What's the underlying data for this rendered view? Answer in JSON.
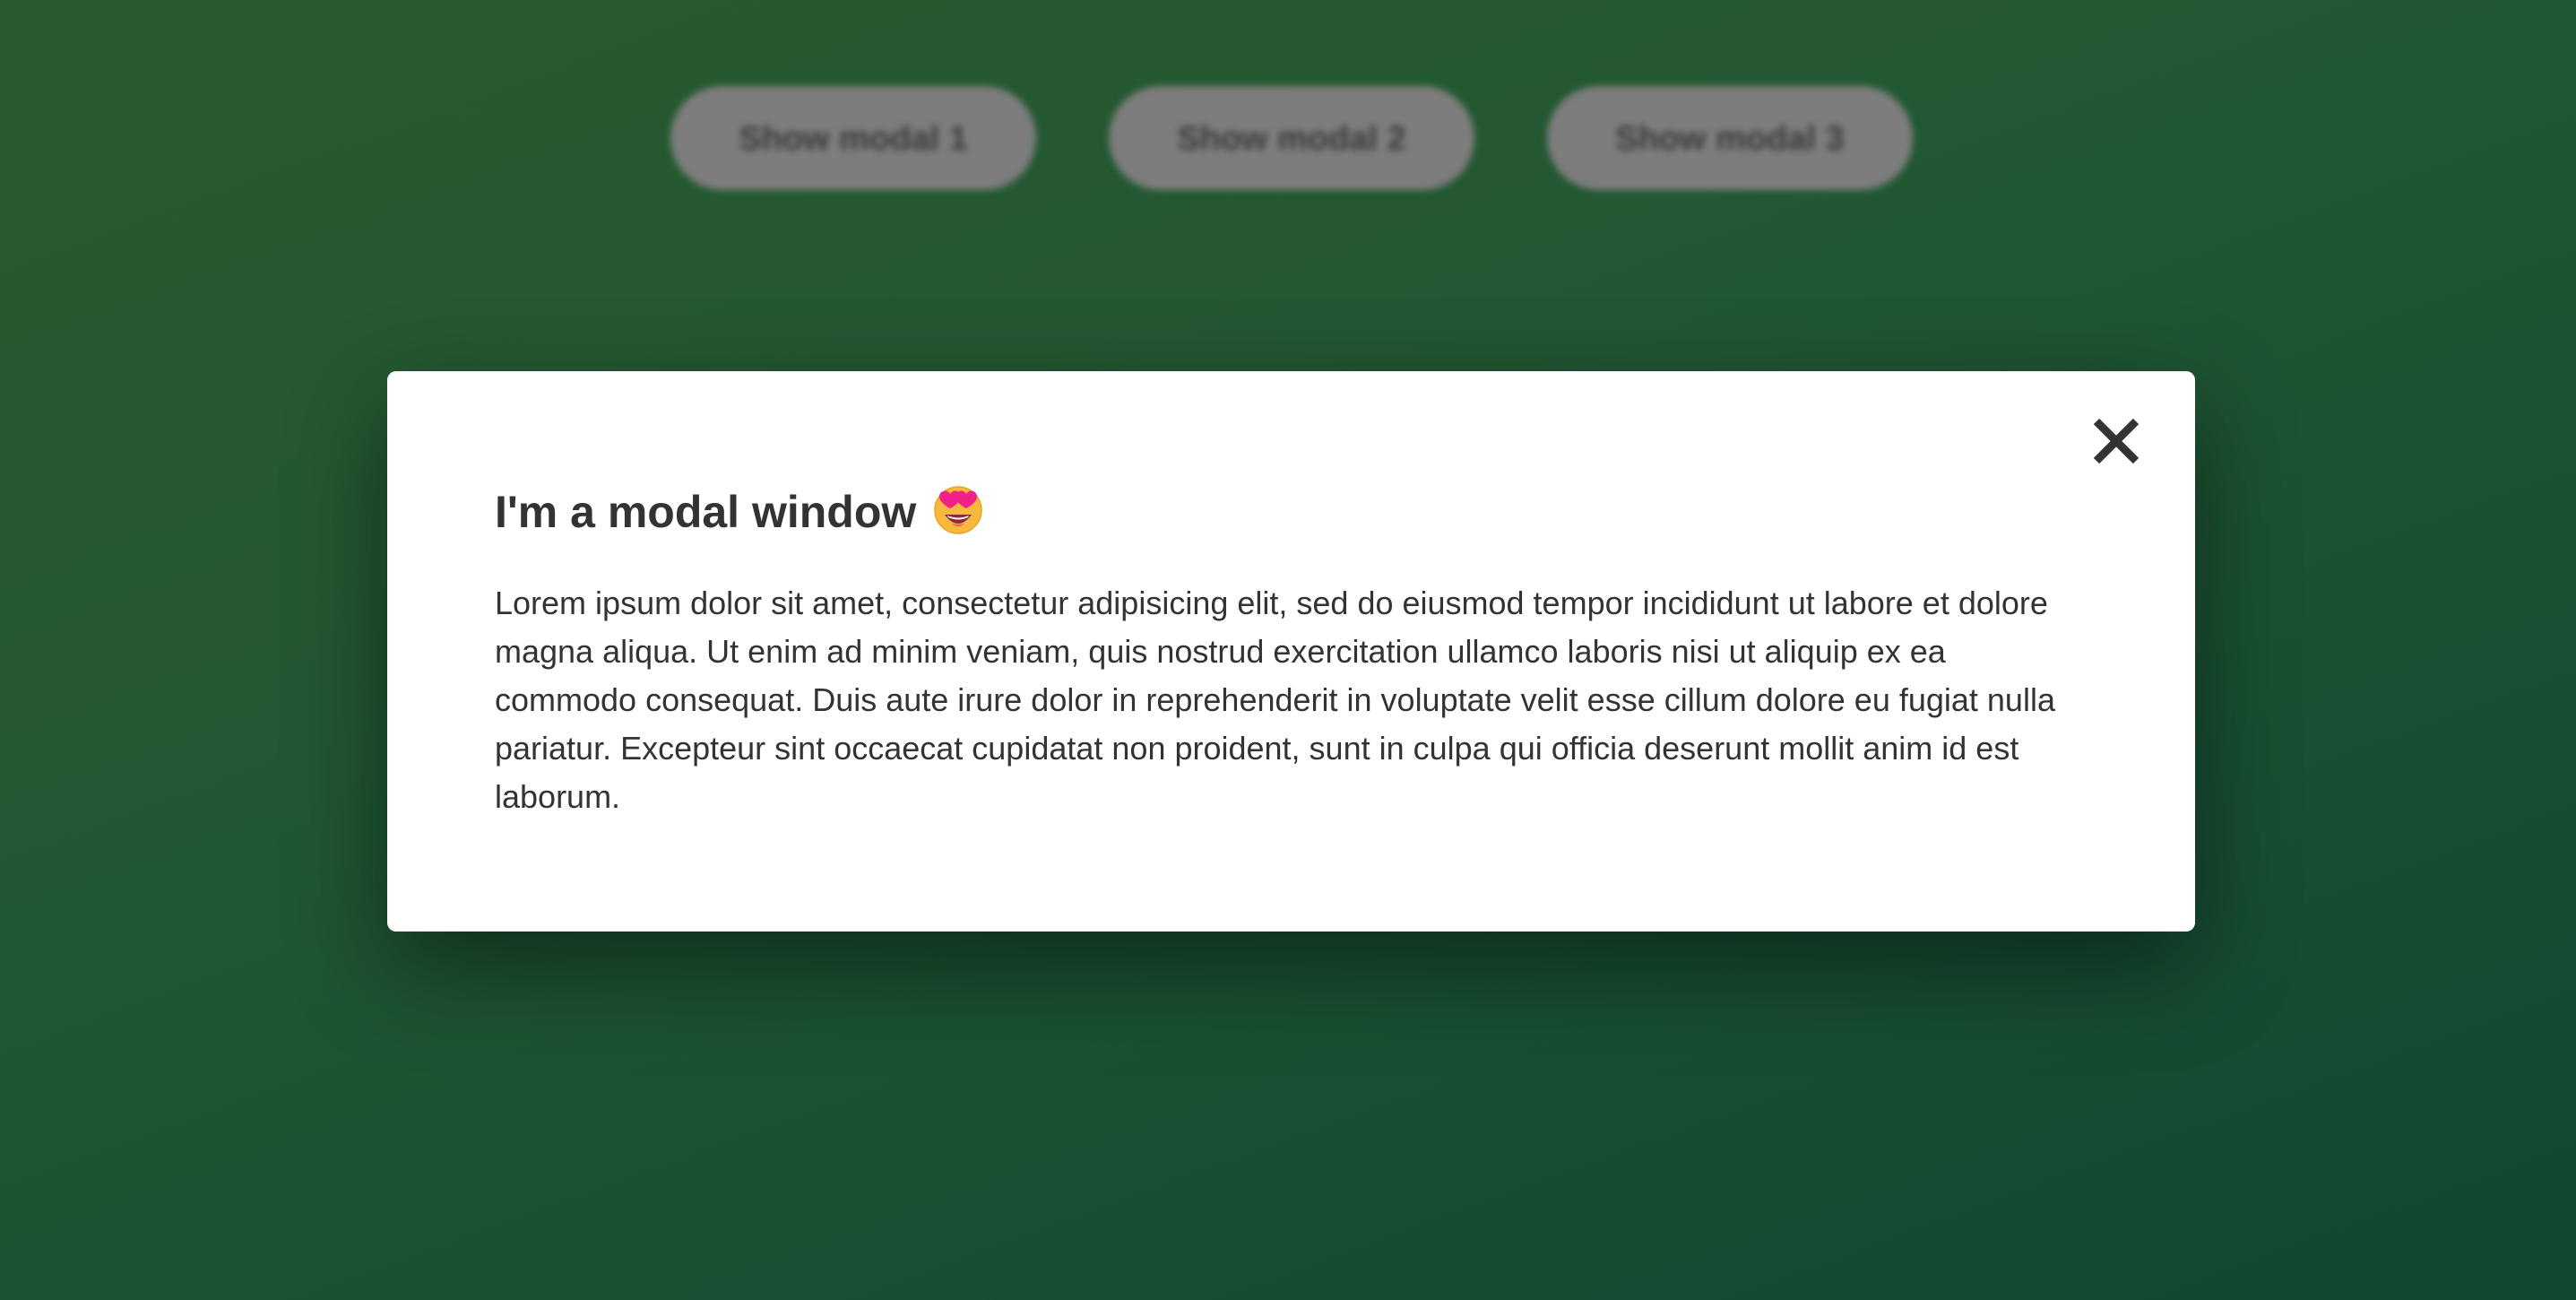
{
  "buttons": [
    {
      "label": "Show modal 1"
    },
    {
      "label": "Show modal 2"
    },
    {
      "label": "Show modal 3"
    }
  ],
  "modal": {
    "title": "I'm a modal window",
    "title_emoji": "smiling-face-with-heart-eyes-icon",
    "close_icon": "close-icon",
    "body": "Lorem ipsum dolor sit amet, consectetur adipisicing elit, sed do eiusmod tempor incididunt ut labore et dolore magna aliqua. Ut enim ad minim veniam, quis nostrud exercitation ullamco laboris nisi ut aliquip ex ea commodo consequat. Duis aute irure dolor in reprehenderit in voluptate velit esse cillum dolore eu fugiat nulla pariatur. Excepteur sint occaecat cupidatat non proident, sunt in culpa qui officia deserunt mollit anim id est laborum."
  },
  "colors": {
    "background_start": "#2e6234",
    "background_end": "#134d36",
    "modal_background": "#ffffff",
    "text": "#333333",
    "button_blurred": "#7d7d7d"
  }
}
